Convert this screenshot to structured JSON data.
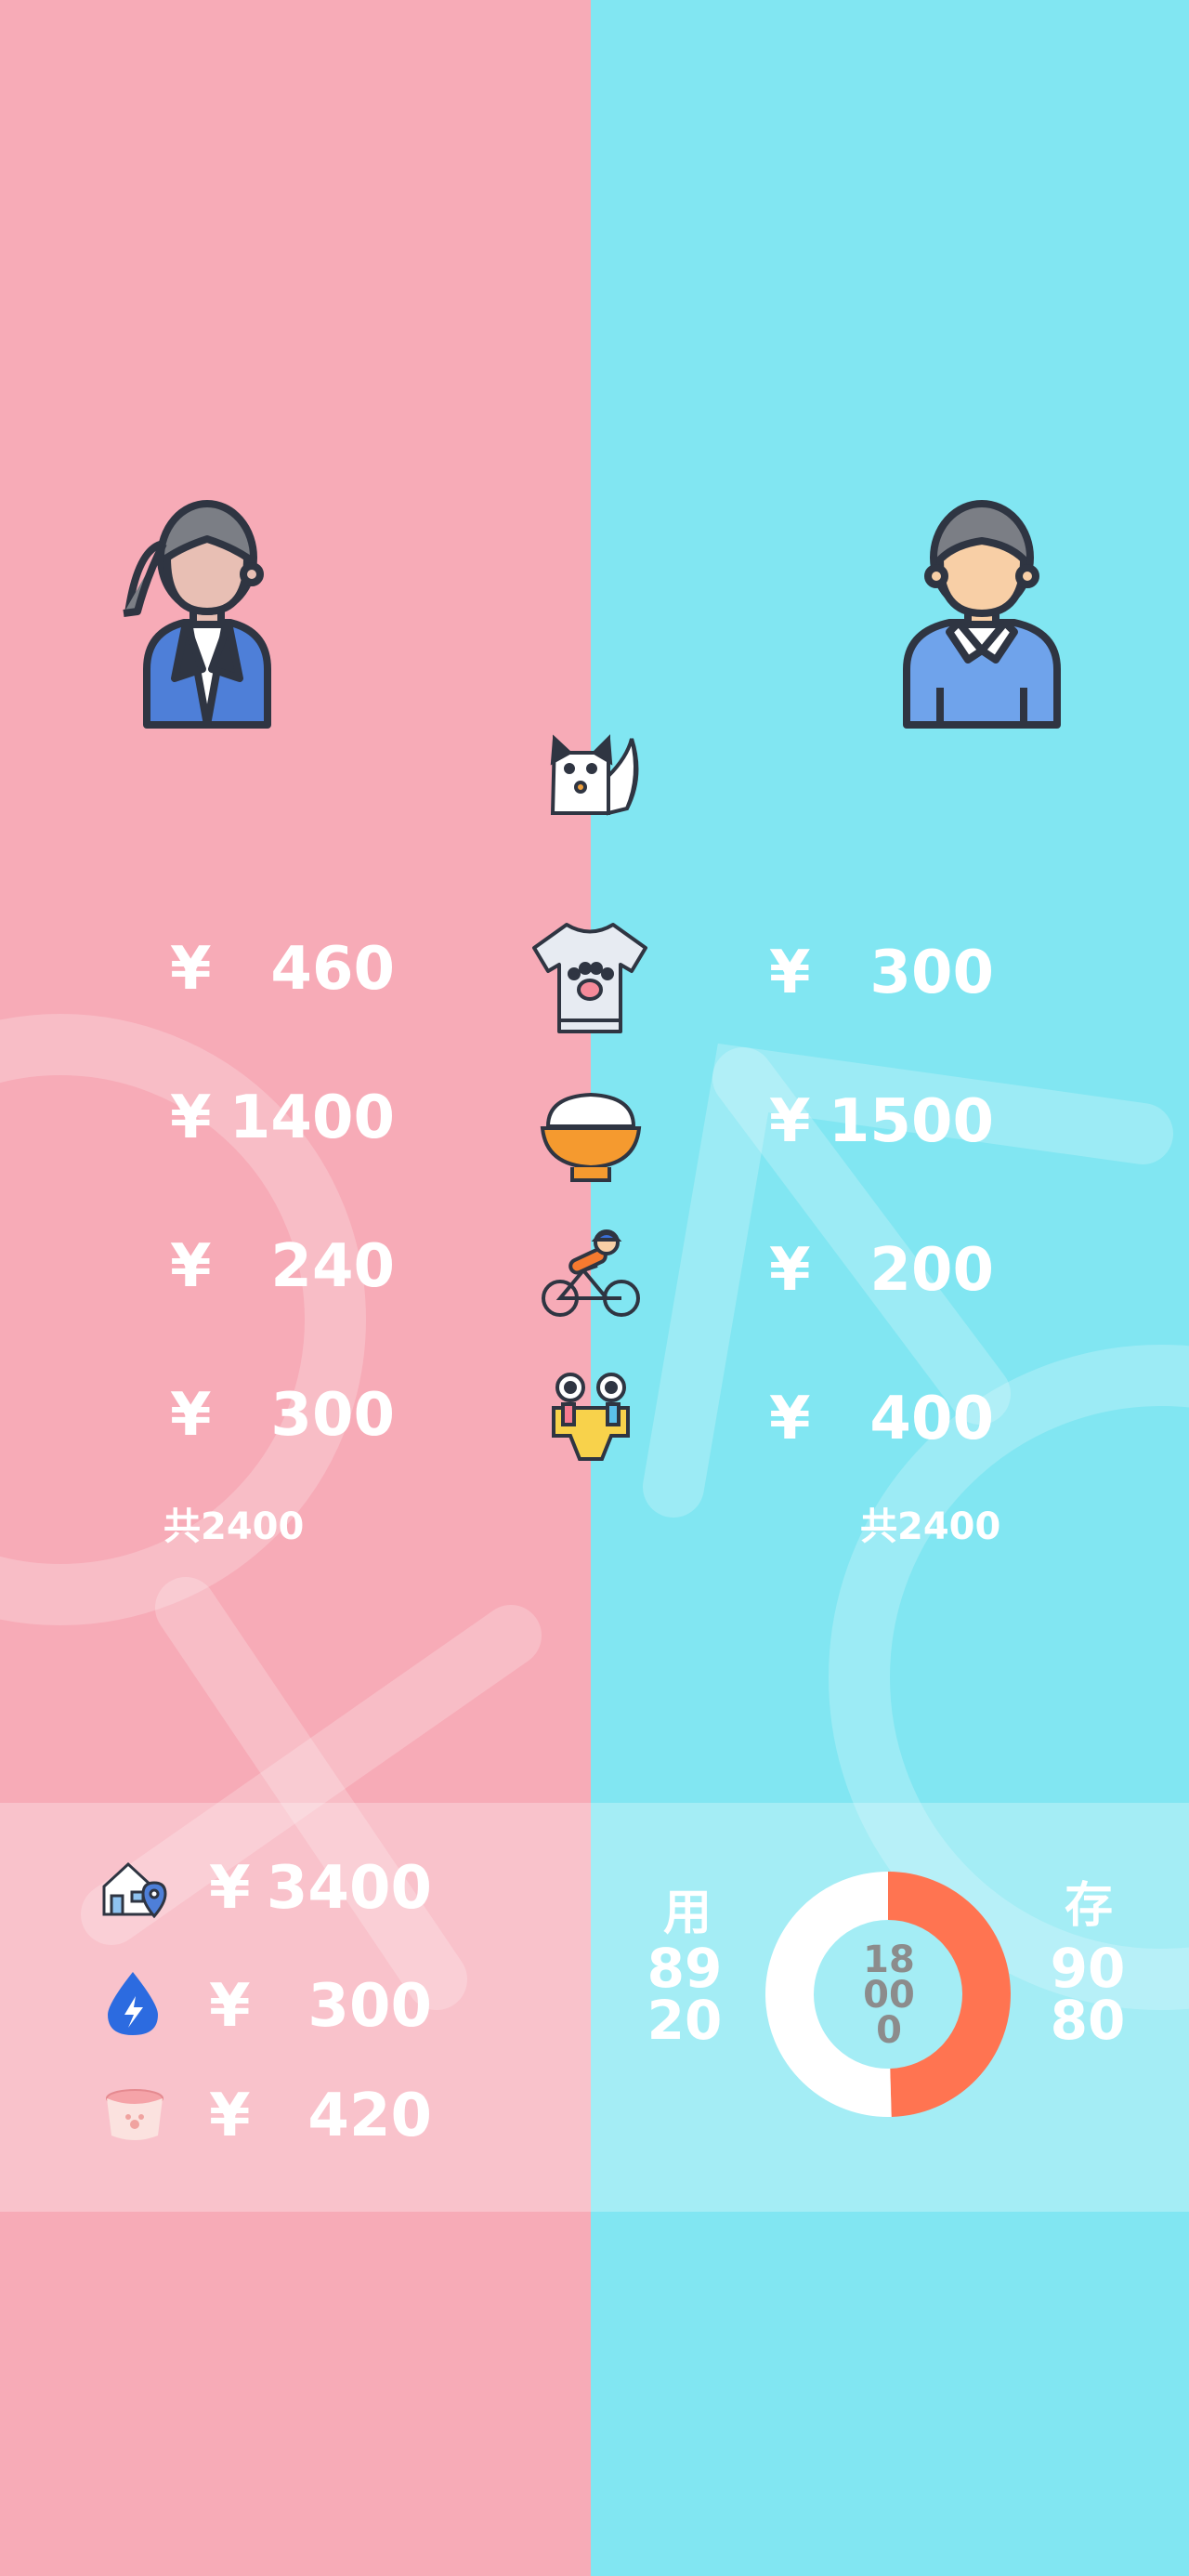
{
  "colors": {
    "female_panel": "#F7ABB7",
    "male_panel": "#81E6F2",
    "donut_used": "#FF7451",
    "donut_saved": "#FFFFFF",
    "text": "#FFFFFF"
  },
  "female": {
    "avatar_icon": "woman-avatar-icon",
    "expenses": [
      {
        "currency": "¥",
        "amount": "460"
      },
      {
        "currency": "¥",
        "amount": "1400"
      },
      {
        "currency": "¥",
        "amount": "240"
      },
      {
        "currency": "¥",
        "amount": "300"
      }
    ],
    "total": "共2400"
  },
  "male": {
    "avatar_icon": "man-avatar-icon",
    "expenses": [
      {
        "currency": "¥",
        "amount": "300"
      },
      {
        "currency": "¥",
        "amount": "1500"
      },
      {
        "currency": "¥",
        "amount": "200"
      },
      {
        "currency": "¥",
        "amount": "400"
      }
    ],
    "total": "共2400"
  },
  "categories": [
    "cat-icon",
    "tshirt-icon",
    "rice-bowl-icon",
    "bicycle-icon",
    "party-icon"
  ],
  "shared_bills": [
    {
      "icon": "house-location-icon",
      "currency": "¥",
      "amount": "3400"
    },
    {
      "icon": "water-electricity-icon",
      "currency": "¥",
      "amount": "300"
    },
    {
      "icon": "pet-bowl-icon",
      "currency": "¥",
      "amount": "420"
    }
  ],
  "summary": {
    "used_label": "用",
    "used_value_line1": "89",
    "used_value_line2": "20",
    "saved_label": "存",
    "saved_value_line1": "90",
    "saved_value_line2": "80",
    "center_line1": "18",
    "center_line2": "00",
    "center_line3": "0",
    "chart_data": {
      "type": "pie",
      "categories": [
        "用",
        "存"
      ],
      "values": [
        8920,
        9080
      ],
      "total": 18000
    }
  }
}
